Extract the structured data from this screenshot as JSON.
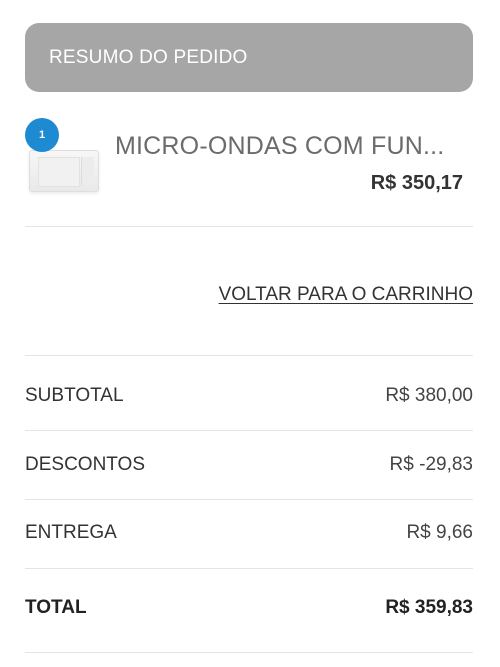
{
  "header": {
    "title": "RESUMO DO PEDIDO"
  },
  "cart_item": {
    "quantity": "1",
    "name": "MICRO-ONDAS COM FUN...",
    "price": "R$ 350,17",
    "thumbnail_icon": "microwave-icon"
  },
  "links": {
    "back_to_cart": "VOLTAR PARA O CARRINHO"
  },
  "summary": {
    "subtotal_label": "SUBTOTAL",
    "subtotal_value": "R$ 380,00",
    "discounts_label": "DESCONTOS",
    "discounts_value": "R$ -29,83",
    "delivery_label": "ENTREGA",
    "delivery_value": "R$ 9,66",
    "total_label": "TOTAL",
    "total_value": "R$ 359,83"
  },
  "colors": {
    "header_bg": "#a6a6a6",
    "badge_bg": "#1e8ad2",
    "divider": "#e4e4e4"
  }
}
